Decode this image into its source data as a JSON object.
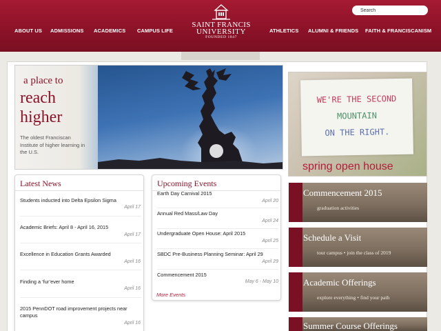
{
  "header": {
    "search_placeholder": "Search",
    "nav_left": [
      "ABOUT US",
      "ADMISSIONS",
      "ACADEMICS",
      "CAMPUS LIFE"
    ],
    "nav_right": [
      "ATHLETICS",
      "ALUMNI & FRIENDS",
      "FAITH & FRANCISCANISM"
    ],
    "logo": {
      "line1": "SAINT FRANCIS",
      "line2": "UNIVERSITY",
      "line3": "FOUNDED 1847"
    }
  },
  "hero": {
    "line1": "a place to",
    "line2": "reach",
    "line3": "higher",
    "description": "The oldest Franciscan Institute of higher learning in the U.S."
  },
  "promo": {
    "sign_lines": [
      "WE'RE THE SECOND",
      "MOUNTAIN",
      "ON THE RIGHT."
    ],
    "caption": "spring open house"
  },
  "news": {
    "title": "Latest News",
    "items": [
      {
        "text": "Students inducted into Delta Epsilon Sigma",
        "date": "April 17"
      },
      {
        "text": "Academic Briefs: April 8 - April 16, 2015",
        "date": "April 17"
      },
      {
        "text": "Excellence in Education Grants Awarded",
        "date": "April 16"
      },
      {
        "text": "Finding a ‘fur’ever home",
        "date": "April 16"
      },
      {
        "text": "2015 PennDOT road improvement projects near campus",
        "date": "April 16"
      }
    ]
  },
  "events": {
    "title": "Upcoming Events",
    "items": [
      {
        "text": "Earth Day Carnival 2015",
        "date": "April 20"
      },
      {
        "text": "Annual Red Mass/Law Day",
        "date": "April 24"
      },
      {
        "text": "Undergraduate Open House: April 2015",
        "date": "April 25"
      },
      {
        "text": "SBDC Pre-Business Planning Seminar: April 29",
        "date": "April 29"
      },
      {
        "text": "Commencement 2015",
        "date": "May 6 - May 10"
      }
    ],
    "more": "More Events"
  },
  "tiles": [
    {
      "title": "Commencement 2015",
      "subtitle": "graduation activities"
    },
    {
      "title": "Schedule a Visit",
      "subtitle": "tour campus • join the class of 2019"
    },
    {
      "title": "Academic Offerings",
      "subtitle": "explore everything • find your path"
    },
    {
      "title": "Summer Course Offerings",
      "subtitle": ""
    }
  ],
  "colors": {
    "brand": "#8b1228",
    "accent": "#b31c3a"
  }
}
